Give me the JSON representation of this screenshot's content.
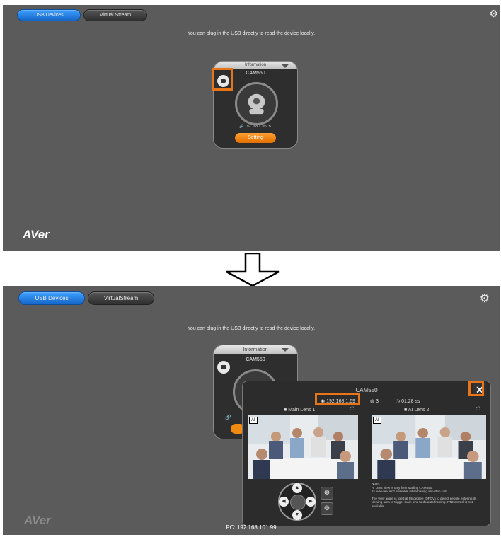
{
  "tabs": {
    "usb": "USB Devices",
    "virtual_top": "Virtual Stream",
    "virtual_bottom": "VirtualStream"
  },
  "message": "You can plug in the USB directly to read the device locally.",
  "logo": "AVer",
  "device": {
    "info_label": "Information",
    "name": "CAM550",
    "ip_top": "192.168.1.169",
    "setting": "Setting"
  },
  "dialog": {
    "title": "CAM550",
    "ip": "192.168.1.69",
    "users": "3",
    "time": "01:28 ss",
    "close": "✕",
    "main_lens": "Main Lens",
    "main_lens_num": "1",
    "ai_lens": "AI Lens",
    "ai_lens_num": "2",
    "tag": "AI",
    "zoom_in": "⊕",
    "zoom_out": "⊖",
    "note_title": "Note :",
    "note_1": "AI Lens view is only for installing CAM550.",
    "note_2": "Its live view isn't available while having an video call.",
    "note_3": "The view angle is fixed at 85 degree (DFOV) to detect people entering its viewing area to trigger main lens to do auto framing. PTZ control is not available."
  },
  "pc": "PC: 192.168.101.99",
  "colors": {
    "panel": "#5b5b5b",
    "active_tab": "#1f7fe0",
    "highlight": "#e8751a",
    "setting": "#f08a10"
  }
}
